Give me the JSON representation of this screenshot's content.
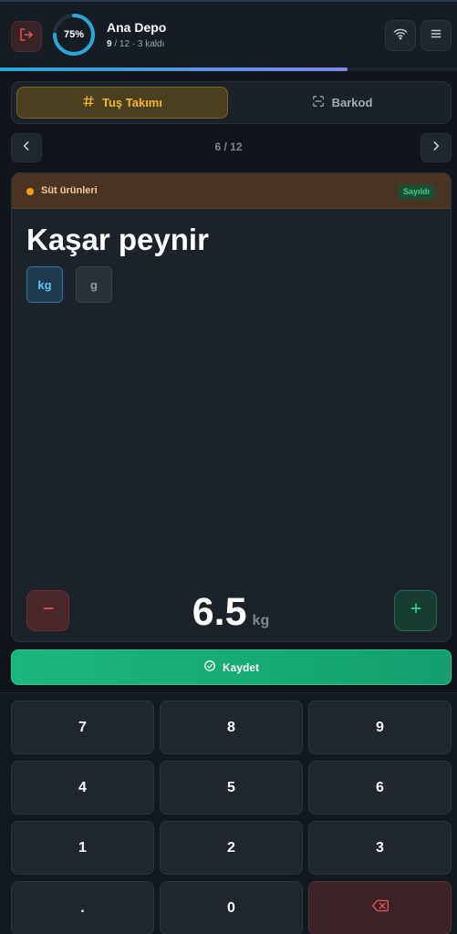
{
  "header": {
    "progress_label": "75%",
    "progress_fraction": 0.75,
    "depot_name": "Ana Depo",
    "counted": "9",
    "total_suffix": " / 12 · 3 kaldı",
    "bar_progress_fraction": 0.76
  },
  "mode": {
    "keypad_label": "Tuş Takımı",
    "barcode_label": "Barkod"
  },
  "pager": {
    "indicator": "6 / 12"
  },
  "product": {
    "category": "Süt ürünleri",
    "status_badge": "Sayıldı",
    "name": "Kaşar peynir",
    "units": [
      "kg",
      "g"
    ],
    "selected_unit": "kg",
    "quantity": "6.5",
    "quantity_unit": "kg"
  },
  "save_label": "Kaydet",
  "keypad": {
    "keys": [
      "7",
      "8",
      "9",
      "4",
      "5",
      "6",
      "1",
      "2",
      "3",
      ".",
      "0"
    ],
    "delete_glyph": "⌫"
  },
  "colors": {
    "accent_keypad": "#f5b82a",
    "save_green": "#1cb77c",
    "unit_selected": "#64c4f0",
    "danger": "#e25454",
    "progress_ring": "#2aa6d8"
  }
}
